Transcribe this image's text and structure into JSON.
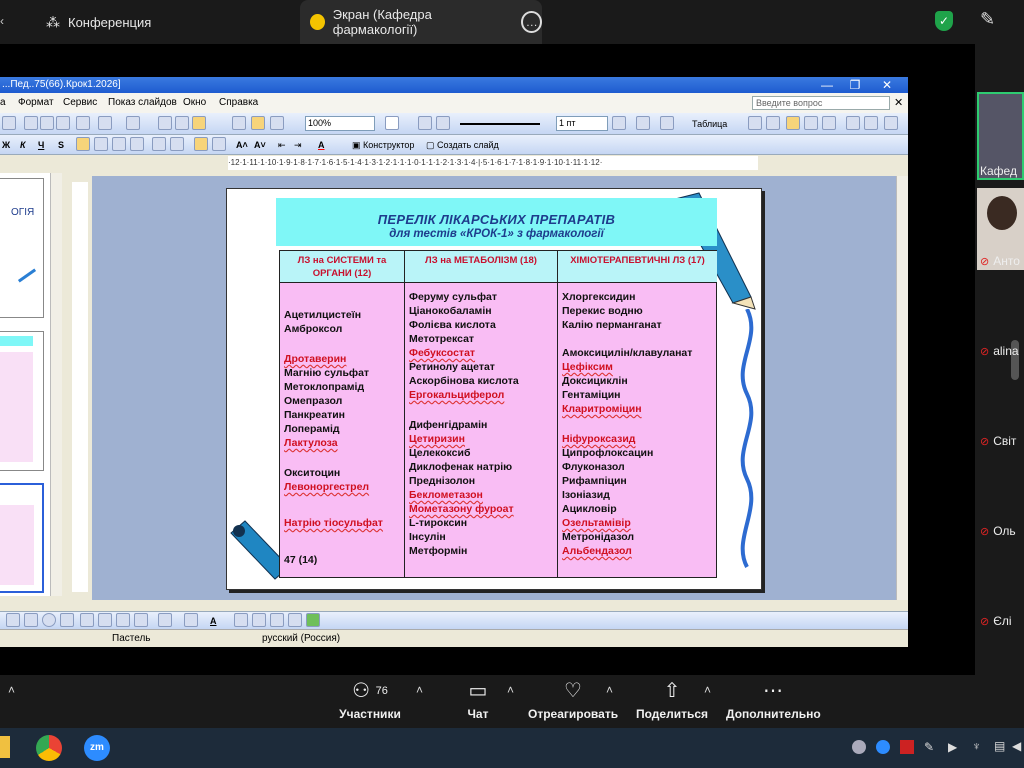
{
  "zoom": {
    "tabs": [
      {
        "label": "Конференция"
      },
      {
        "label": "Экран (Кафедра фармакології)"
      }
    ],
    "controls": [
      {
        "label": "Участники",
        "count": "76"
      },
      {
        "label": "Чат"
      },
      {
        "label": "Отреагировать"
      },
      {
        "label": "Поделиться"
      },
      {
        "label": "Дополнительно"
      }
    ],
    "participants": [
      {
        "name": "Кафед"
      },
      {
        "name": "Анто"
      },
      {
        "name": "alina"
      },
      {
        "name": "Світ"
      },
      {
        "name": "Оль"
      },
      {
        "name": "Єлі"
      }
    ]
  },
  "ppt": {
    "window_title": "...Пед..75(66).Крок1.2026]",
    "menu": [
      "а",
      "Формат",
      "Сервис",
      "Показ слайдов",
      "Окно",
      "Справка"
    ],
    "help_placeholder": "Введите вопрос",
    "zoom": "100%",
    "line_pt": "1 пт",
    "table_label": "Таблица",
    "constructor_label": "Конструктор",
    "new_slide_label": "Создать слайд",
    "ruler_text": "·12·1·11·1·10·1·9·1·8·1·7·1·6·1·5·1·4·1·3·1·2·1·1·1·0·1·1·1·2·1·3·1·4·|·5·1·6·1·7·1·8·1·9·1·10·1·11·1·12·",
    "status": {
      "design": "Пастель",
      "language": "русский (Россия)"
    }
  },
  "slide": {
    "title": "ПЕРЕЛІК ЛІКАРСЬКИХ ПРЕПАРАТІВ",
    "subtitle": "для тестів «КРОК-1» з фармакології",
    "columns": [
      {
        "header": "ЛЗ на СИСТЕМИ та ОРГАНИ (12)",
        "items": [
          {
            "text": "Ацетилцистеїн",
            "color": "black"
          },
          {
            "text": "Амброксол",
            "color": "black"
          },
          {
            "text": "Дротаверин",
            "color": "red"
          },
          {
            "text": "Магнію сульфат",
            "color": "black"
          },
          {
            "text": "Метоклопрамід",
            "color": "black"
          },
          {
            "text": "Омепразол",
            "color": "black"
          },
          {
            "text": "Панкреатин",
            "color": "black"
          },
          {
            "text": "Лоперамід",
            "color": "black"
          },
          {
            "text": "Лактулоза",
            "color": "red"
          },
          {
            "text": "Окситоцин",
            "color": "black"
          },
          {
            "text": "Левоноргестрел",
            "color": "red"
          },
          {
            "text": "Натрію тіосульфат",
            "color": "red"
          },
          {
            "text": "47 (14)",
            "color": "black"
          }
        ]
      },
      {
        "header": "ЛЗ на МЕТАБОЛІЗМ (18)",
        "items": [
          {
            "text": "Феруму сульфат",
            "color": "black"
          },
          {
            "text": "Ціанокобаламін",
            "color": "black"
          },
          {
            "text": "Фолієва кислота",
            "color": "black"
          },
          {
            "text": "Метотрексат",
            "color": "black"
          },
          {
            "text": "Фебуксостат",
            "color": "red"
          },
          {
            "text": "Ретинолу ацетат",
            "color": "black"
          },
          {
            "text": "Аскорбінова кислота",
            "color": "black"
          },
          {
            "text": "Ергокальциферол",
            "color": "red"
          },
          {
            "text": "Дифенгідрамін",
            "color": "black"
          },
          {
            "text": "Цетиризин",
            "color": "red"
          },
          {
            "text": "Целекоксиб",
            "color": "black"
          },
          {
            "text": "Диклофенак натрію",
            "color": "black"
          },
          {
            "text": "Преднізолон",
            "color": "black"
          },
          {
            "text": "Беклометазон",
            "color": "red"
          },
          {
            "text": "Мометазону фуроат",
            "color": "red"
          },
          {
            "text": "L-тироксин",
            "color": "black"
          },
          {
            "text": "Інсулін",
            "color": "black"
          },
          {
            "text": "Метформін",
            "color": "black"
          }
        ]
      },
      {
        "header": "ХІМІОТЕРАПЕВТИЧНІ ЛЗ (17)",
        "items": [
          {
            "text": "Хлоргексидин",
            "color": "black"
          },
          {
            "text": "Перекис водню",
            "color": "black"
          },
          {
            "text": "Калію перманганат",
            "color": "black"
          },
          {
            "text": "Амоксицилін/клавуланат",
            "color": "black"
          },
          {
            "text": "Цефіксим",
            "color": "red"
          },
          {
            "text": "Доксициклін",
            "color": "black"
          },
          {
            "text": "Гентаміцин",
            "color": "black"
          },
          {
            "text": "Кларитроміцин",
            "color": "red"
          },
          {
            "text": "Ніфуроксазид",
            "color": "red"
          },
          {
            "text": "Ципрофлоксацин",
            "color": "black"
          },
          {
            "text": "Флуконазол",
            "color": "black"
          },
          {
            "text": "Рифампіцин",
            "color": "black"
          },
          {
            "text": "Ізоніазид",
            "color": "black"
          },
          {
            "text": "Ацикловір",
            "color": "black"
          },
          {
            "text": "Озельтамівір",
            "color": "red"
          },
          {
            "text": "Метронідазол",
            "color": "black"
          },
          {
            "text": "Альбендазол",
            "color": "red"
          }
        ]
      }
    ]
  },
  "thumbnail_text": "ОГІЯ",
  "colors": {
    "slide_header_bg": "#7ff7f7",
    "table_bg": "#f9bdf4",
    "red_text": "#d01020",
    "title_text": "#1e3c8c"
  }
}
